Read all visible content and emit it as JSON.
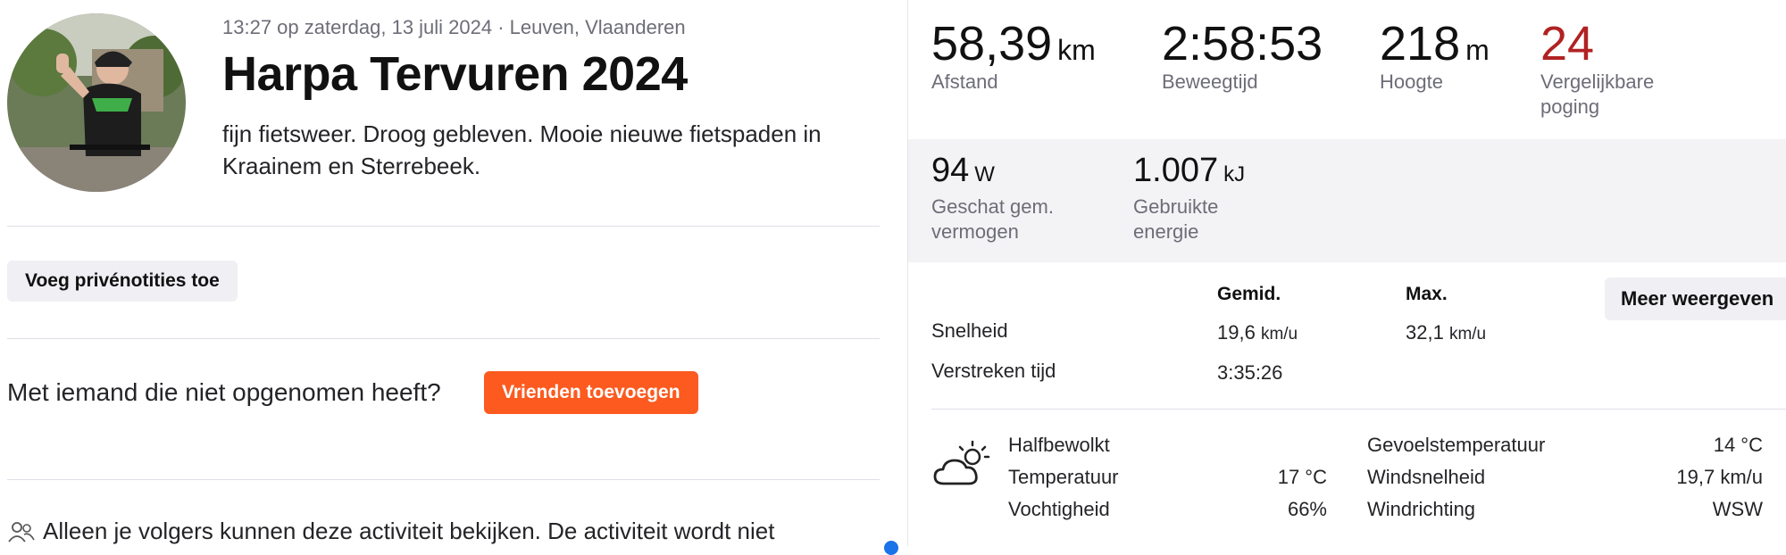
{
  "activity": {
    "meta": "13:27 op zaterdag, 13 juli 2024 · Leuven, Vlaanderen",
    "title": "Harpa Tervuren 2024",
    "description": "fijn fietsweer. Droog gebleven. Mooie nieuwe fietspaden in Kraainem en Sterrebeek."
  },
  "actions": {
    "private_notes": "Voeg privénotities toe",
    "friends_question": "Met iemand die niet opgenomen heeft?",
    "add_friends": "Vrienden toevoegen",
    "privacy": "Alleen je volgers kunnen deze activiteit bekijken. De activiteit wordt niet"
  },
  "stats": {
    "distance": {
      "value": "58,39",
      "unit": "km",
      "label": "Afstand"
    },
    "moving_time": {
      "value": "2:58:53",
      "label": "Beweegtijd"
    },
    "elevation": {
      "value": "218",
      "unit": "m",
      "label": "Hoogte"
    },
    "efforts": {
      "value": "24",
      "label": "Vergelijkbare poging"
    }
  },
  "power": {
    "avg_power": {
      "value": "94",
      "unit": "W",
      "label": "Geschat gem. vermogen"
    },
    "energy": {
      "value": "1.007",
      "unit": "kJ",
      "label": "Gebruikte energie"
    }
  },
  "table": {
    "head_avg": "Gemid.",
    "head_max": "Max.",
    "more_button": "Meer weergeven",
    "speed": {
      "label": "Snelheid",
      "avg": "19,6",
      "avg_unit": "km/u",
      "max": "32,1",
      "max_unit": "km/u"
    },
    "elapsed": {
      "label": "Verstreken tijd",
      "avg": "3:35:26"
    }
  },
  "weather": {
    "condition": "Halfbewolkt",
    "temperature_label": "Temperatuur",
    "temperature_value": "17 °C",
    "humidity_label": "Vochtigheid",
    "humidity_value": "66%",
    "feels_like_label": "Gevoelstemperatuur",
    "feels_like_value": "14 °C",
    "wind_speed_label": "Windsnelheid",
    "wind_speed_value": "19,7 km/u",
    "wind_dir_label": "Windrichting",
    "wind_dir_value": "WSW"
  },
  "colors": {
    "accent": "#fc5a1f",
    "pr_red": "#b12223"
  },
  "icons": {
    "avatar": "athlete-photo",
    "privacy": "people-icon",
    "weather": "partly-cloudy-icon"
  }
}
